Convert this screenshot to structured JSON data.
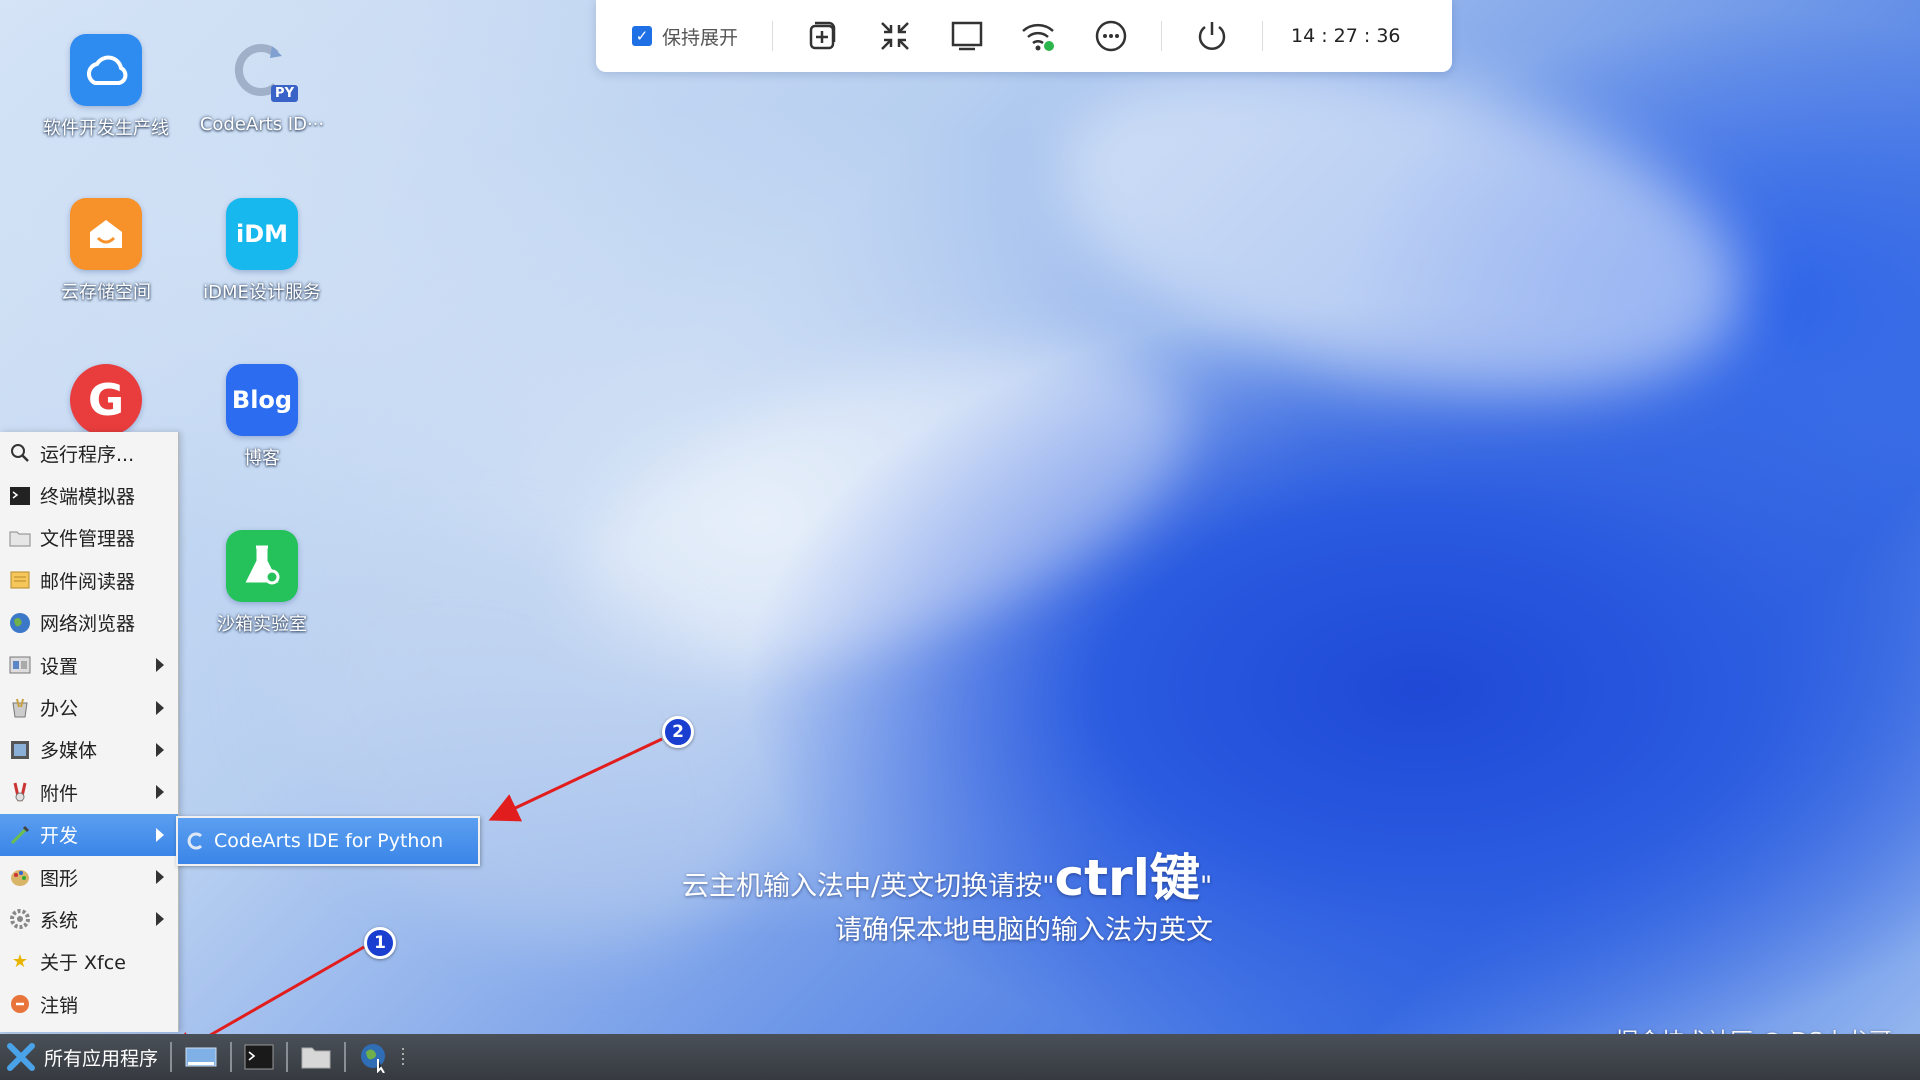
{
  "desktop_icons": [
    {
      "label": "软件开发生产线",
      "icon": "cloud-devops-icon",
      "color": "#2e8cf0"
    },
    {
      "label": "CodeArts ID···",
      "icon": "codearts-python-icon",
      "color": "#e9eef5",
      "badge": "PY"
    },
    {
      "label": "云存储空间",
      "icon": "cloud-storage-icon",
      "color": "#f7922a"
    },
    {
      "label": "iDME设计服务",
      "icon": "idme-icon",
      "color": "#16b8ee",
      "glyph": "iDM"
    },
    {
      "label": "",
      "icon": "gitcode-icon",
      "color": "#e93d3d",
      "glyph": "G"
    },
    {
      "label": "博客",
      "icon": "blog-icon",
      "color": "#2b6cf0",
      "glyph": "Blog"
    },
    {
      "label": "沙箱实验室",
      "icon": "sandbox-lab-icon",
      "color": "#25c15a"
    }
  ],
  "toolbar": {
    "keep_expanded_label": "保持展开",
    "keep_expanded_checked": true,
    "buttons": [
      "add-window-icon",
      "collapse-icon",
      "monitor-icon",
      "wifi-icon",
      "more-icon",
      "power-icon"
    ],
    "clock": "14 : 27 : 36"
  },
  "start_menu": {
    "items": [
      {
        "label": "运行程序...",
        "icon": "search-icon",
        "submenu": false
      },
      {
        "label": "终端模拟器",
        "icon": "terminal-icon",
        "submenu": false
      },
      {
        "label": "文件管理器",
        "icon": "folder-icon",
        "submenu": false
      },
      {
        "label": "邮件阅读器",
        "icon": "mail-icon",
        "submenu": false
      },
      {
        "label": "网络浏览器",
        "icon": "globe-icon",
        "submenu": false
      },
      {
        "label": "设置",
        "icon": "settings-icon",
        "submenu": true
      },
      {
        "label": "办公",
        "icon": "office-icon",
        "submenu": true
      },
      {
        "label": "多媒体",
        "icon": "multimedia-icon",
        "submenu": true
      },
      {
        "label": "附件",
        "icon": "accessories-icon",
        "submenu": true
      },
      {
        "label": "开发",
        "icon": "develop-icon",
        "submenu": true,
        "active": true
      },
      {
        "label": "图形",
        "icon": "graphics-icon",
        "submenu": true
      },
      {
        "label": "系统",
        "icon": "system-icon",
        "submenu": true
      },
      {
        "label": "关于 Xfce",
        "icon": "star-icon",
        "submenu": false
      },
      {
        "label": "注销",
        "icon": "logout-icon",
        "submenu": false
      }
    ],
    "submenu_item": "CodeArts IDE for Python"
  },
  "taskbar": {
    "apps_menu_label": "所有应用程序",
    "launchers": [
      "show-desktop-icon",
      "terminal-icon",
      "folder-icon",
      "browser-icon"
    ]
  },
  "overlay": {
    "ime_hint_prefix": "云主机输入法中/英文切换请按\"",
    "ime_hint_key": "ctrl键",
    "ime_hint_suffix": "\"",
    "ime_hint_line2": "请确保本地电脑的输入法为英文",
    "watermark": "掘金技术社区 @ DS小龙哥",
    "badge_1": "1",
    "badge_2": "2",
    "arrow_color": "#e11d1d"
  }
}
